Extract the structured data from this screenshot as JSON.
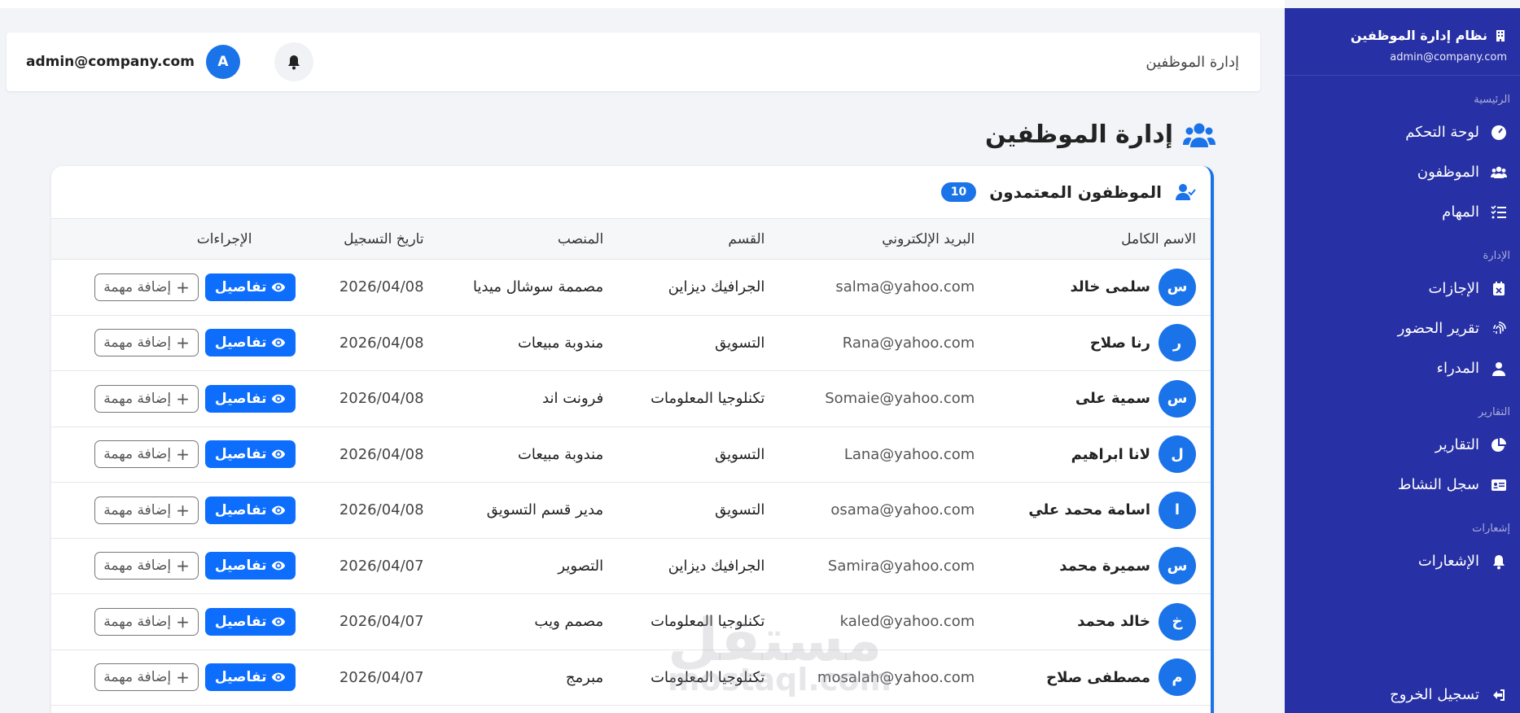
{
  "sidebar": {
    "title": "نظام إدارة الموظفين",
    "email": "admin@company.com",
    "sections": {
      "main": "الرئيسية",
      "management": "الإدارة",
      "reports": "التقارير",
      "notifications": "إشعارات"
    },
    "items": [
      {
        "label": "لوحة التحكم",
        "icon": "dashboard-icon"
      },
      {
        "label": "الموظفون",
        "icon": "users-icon"
      },
      {
        "label": "المهام",
        "icon": "tasks-icon"
      },
      {
        "label": "الإجازات",
        "icon": "calendar-x-icon"
      },
      {
        "label": "تقرير الحضور",
        "icon": "fingerprint-icon"
      },
      {
        "label": "المدراء",
        "icon": "user-icon"
      },
      {
        "label": "التقارير",
        "icon": "pie-chart-icon"
      },
      {
        "label": "سجل النشاط",
        "icon": "id-card-icon"
      },
      {
        "label": "الإشعارات",
        "icon": "bell-icon"
      }
    ],
    "logout": "تسجيل الخروج"
  },
  "header": {
    "title": "إدارة الموظفين",
    "email": "admin@company.com",
    "avatar_letter": "A"
  },
  "page": {
    "title": "إدارة الموظفين"
  },
  "card": {
    "title": "الموظفون المعتمدون",
    "count": "10",
    "columns": [
      "الاسم الكامل",
      "البريد الإلكتروني",
      "القسم",
      "المنصب",
      "تاريخ التسجيل",
      "الإجراءات"
    ],
    "details_label": "تفاصيل",
    "add_task_label": "إضافة مهمة",
    "rows": [
      {
        "initial": "س",
        "name": "سلمى خالد",
        "email": "salma@yahoo.com",
        "dept": "الجرافيك ديزاين",
        "role": "مصممة سوشال ميديا",
        "date": "2026/04/08"
      },
      {
        "initial": "ر",
        "name": "رنا صلاح",
        "email": "Rana@yahoo.com",
        "dept": "التسويق",
        "role": "مندوبة مبيعات",
        "date": "2026/04/08"
      },
      {
        "initial": "س",
        "name": "سمية على",
        "email": "Somaie@yahoo.com",
        "dept": "تكنلوجيا المعلومات",
        "role": "فرونت اند",
        "date": "2026/04/08"
      },
      {
        "initial": "ل",
        "name": "لانا ابراهيم",
        "email": "Lana@yahoo.com",
        "dept": "التسويق",
        "role": "مندوبة مبيعات",
        "date": "2026/04/08"
      },
      {
        "initial": "ا",
        "name": "اسامة محمد علي",
        "email": "osama@yahoo.com",
        "dept": "التسويق",
        "role": "مدير قسم التسويق",
        "date": "2026/04/08"
      },
      {
        "initial": "س",
        "name": "سميرة محمد",
        "email": "Samira@yahoo.com",
        "dept": "الجرافيك ديزاين",
        "role": "التصوير",
        "date": "2026/04/07"
      },
      {
        "initial": "خ",
        "name": "خالد محمد",
        "email": "kaled@yahoo.com",
        "dept": "تكنلوجيا المعلومات",
        "role": "مصمم ويب",
        "date": "2026/04/07"
      },
      {
        "initial": "م",
        "name": "مصطفى صلاح",
        "email": "mosalah@yahoo.com",
        "dept": "تكنلوجيا المعلومات",
        "role": "مبرمج",
        "date": "2026/04/07"
      }
    ]
  },
  "watermark": {
    "logo": "مستقل",
    "text": "mostaql.com"
  }
}
